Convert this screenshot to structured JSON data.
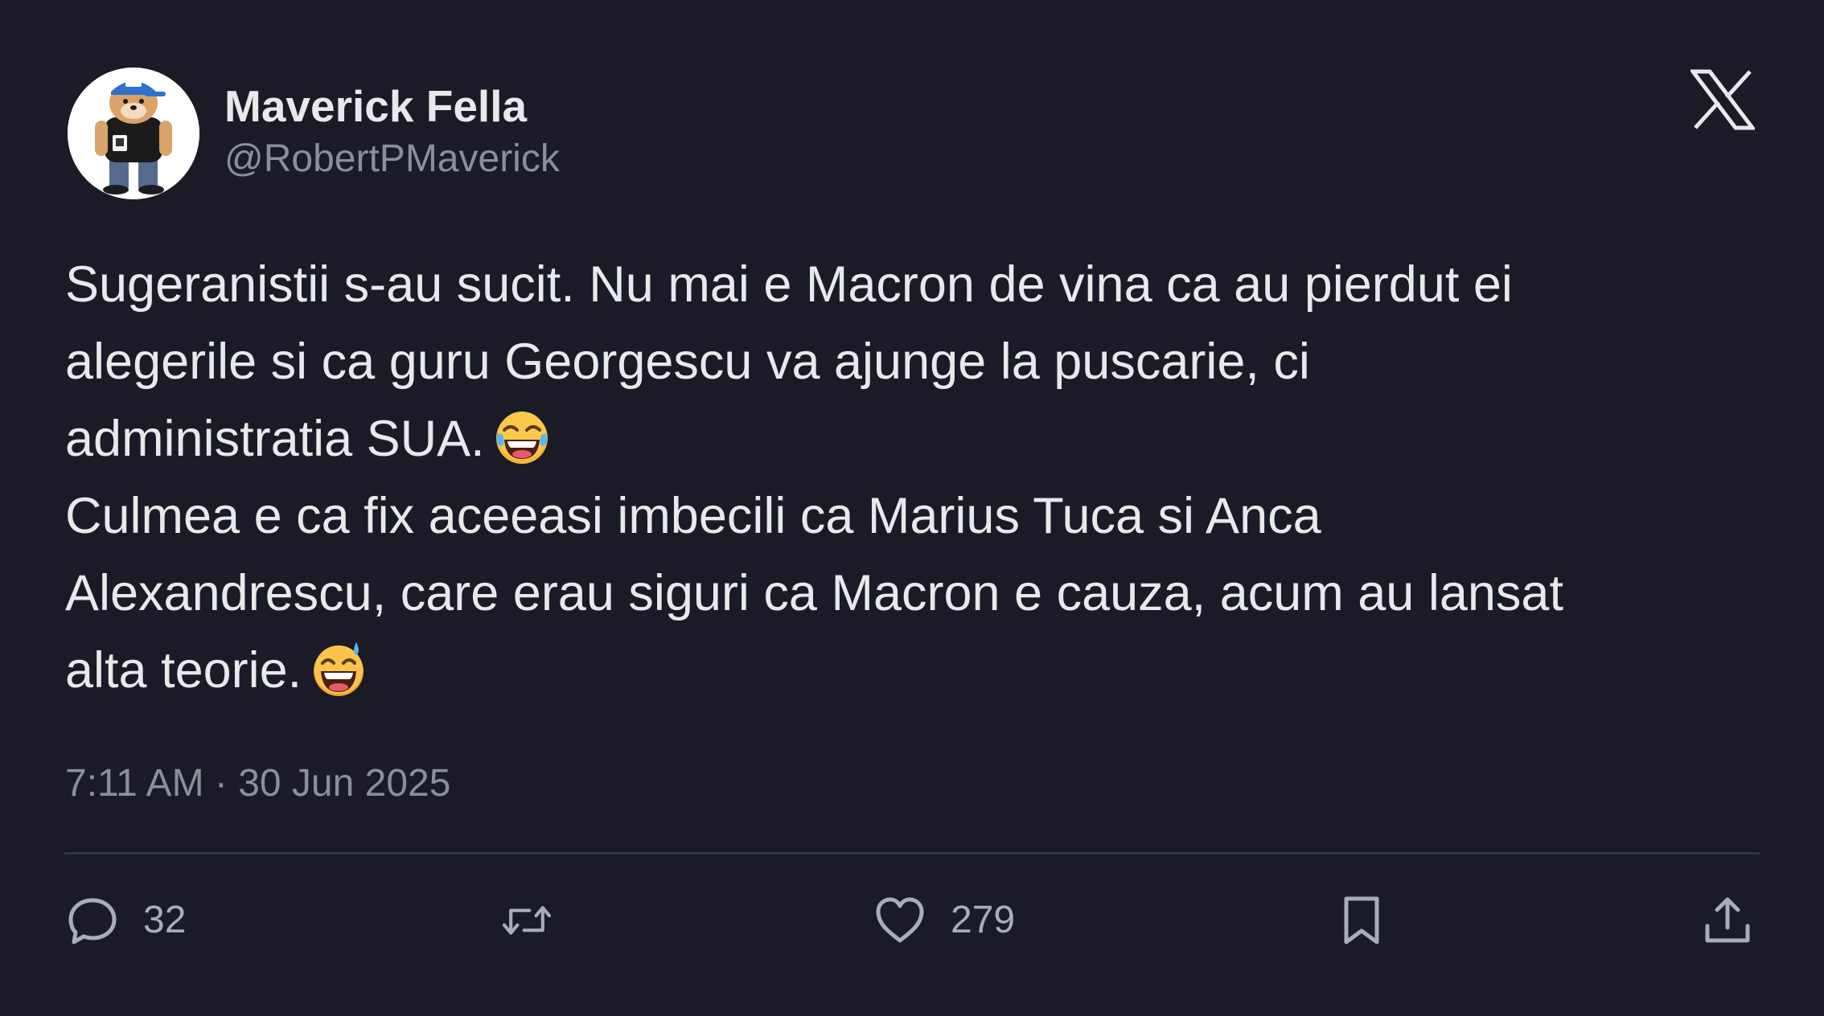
{
  "author": {
    "display_name": "Maverick Fella",
    "handle": "@RobertPMaverick",
    "avatar_icon": "dog-avatar-icon"
  },
  "brand": {
    "logo_icon": "x-logo-icon"
  },
  "tweet": {
    "lines": [
      "Sugeranistii s-au sucit. Nu mai e Macron de vina ca au pierdut ei",
      "alegerile si ca guru Georgescu va ajunge la puscarie, ci",
      "administratia SUA.",
      "Culmea e ca fix aceeasi imbecili ca Marius Tuca si Anca",
      "Alexandrescu, care erau siguri ca Macron e cauza, acum au lansat",
      "alta teorie."
    ],
    "emojis": [
      "tears-of-joy-emoji",
      "grinning-sweat-emoji"
    ]
  },
  "timestamp": "7:11 AM · 30 Jun 2025",
  "actions": {
    "reply_count": "32",
    "like_count": "279",
    "icons": [
      "reply-icon",
      "repost-icon",
      "like-icon",
      "bookmark-icon",
      "share-icon"
    ]
  },
  "colors": {
    "background": "#1a1b27",
    "text_primary": "#e7e9ea",
    "text_secondary": "#8b8f98",
    "divider": "#2f3340",
    "icon": "#a8adb6"
  }
}
